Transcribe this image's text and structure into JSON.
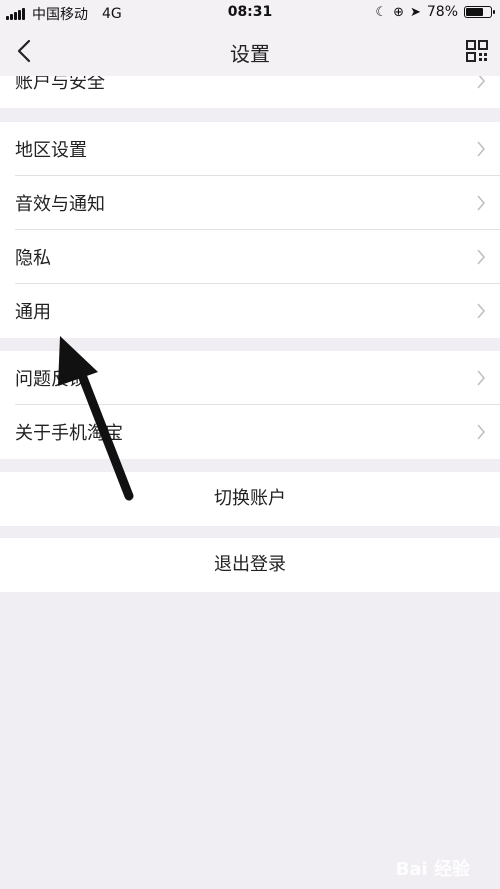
{
  "status_bar": {
    "carrier": "中国移动",
    "network": "4G",
    "time": "08:31",
    "battery": "78%",
    "battery_level": 0.78
  },
  "nav": {
    "title": "设置"
  },
  "groups": [
    {
      "items": [
        {
          "label": "账户与安全"
        }
      ]
    },
    {
      "items": [
        {
          "label": "地区设置"
        },
        {
          "label": "音效与通知"
        },
        {
          "label": "隐私"
        },
        {
          "label": "通用"
        }
      ]
    },
    {
      "items": [
        {
          "label": "问题反馈"
        },
        {
          "label": "关于手机淘宝"
        }
      ]
    }
  ],
  "actions": {
    "switch_account": "切换账户",
    "logout": "退出登录"
  },
  "watermark": "Bai 经验"
}
